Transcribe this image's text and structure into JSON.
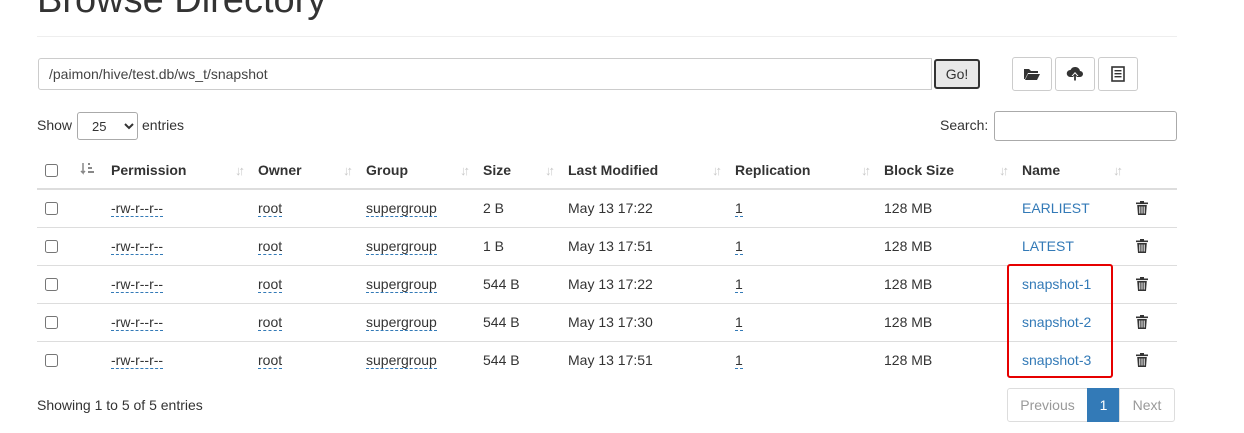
{
  "page": {
    "title": "Browse Directory"
  },
  "path_bar": {
    "value": "/paimon/hive/test.db/ws_t/snapshot",
    "go_label": "Go!"
  },
  "toolbar": {
    "icons": [
      "folder-open-icon",
      "cloud-upload-icon",
      "list-icon"
    ]
  },
  "controls": {
    "show_label": "Show",
    "entries_label": "entries",
    "page_size": "25",
    "page_size_options": [
      "25"
    ],
    "search_label": "Search:",
    "search_value": ""
  },
  "table": {
    "columns": [
      "Permission",
      "Owner",
      "Group",
      "Size",
      "Last Modified",
      "Replication",
      "Block Size",
      "Name"
    ],
    "rows": [
      {
        "permission": "-rw-r--r--",
        "owner": "root",
        "group": "supergroup",
        "size": "2 B",
        "last_modified": "May 13 17:22",
        "replication": "1",
        "block_size": "128 MB",
        "name": "EARLIEST"
      },
      {
        "permission": "-rw-r--r--",
        "owner": "root",
        "group": "supergroup",
        "size": "1 B",
        "last_modified": "May 13 17:51",
        "replication": "1",
        "block_size": "128 MB",
        "name": "LATEST"
      },
      {
        "permission": "-rw-r--r--",
        "owner": "root",
        "group": "supergroup",
        "size": "544 B",
        "last_modified": "May 13 17:22",
        "replication": "1",
        "block_size": "128 MB",
        "name": "snapshot-1"
      },
      {
        "permission": "-rw-r--r--",
        "owner": "root",
        "group": "supergroup",
        "size": "544 B",
        "last_modified": "May 13 17:30",
        "replication": "1",
        "block_size": "128 MB",
        "name": "snapshot-2"
      },
      {
        "permission": "-rw-r--r--",
        "owner": "root",
        "group": "supergroup",
        "size": "544 B",
        "last_modified": "May 13 17:51",
        "replication": "1",
        "block_size": "128 MB",
        "name": "snapshot-3"
      }
    ]
  },
  "footer": {
    "info": "Showing 1 to 5 of 5 entries",
    "previous_label": "Previous",
    "current_page": "1",
    "next_label": "Next"
  },
  "colors": {
    "link": "#337ab7",
    "highlight": "#e60000",
    "active_page": "#337ab7"
  }
}
